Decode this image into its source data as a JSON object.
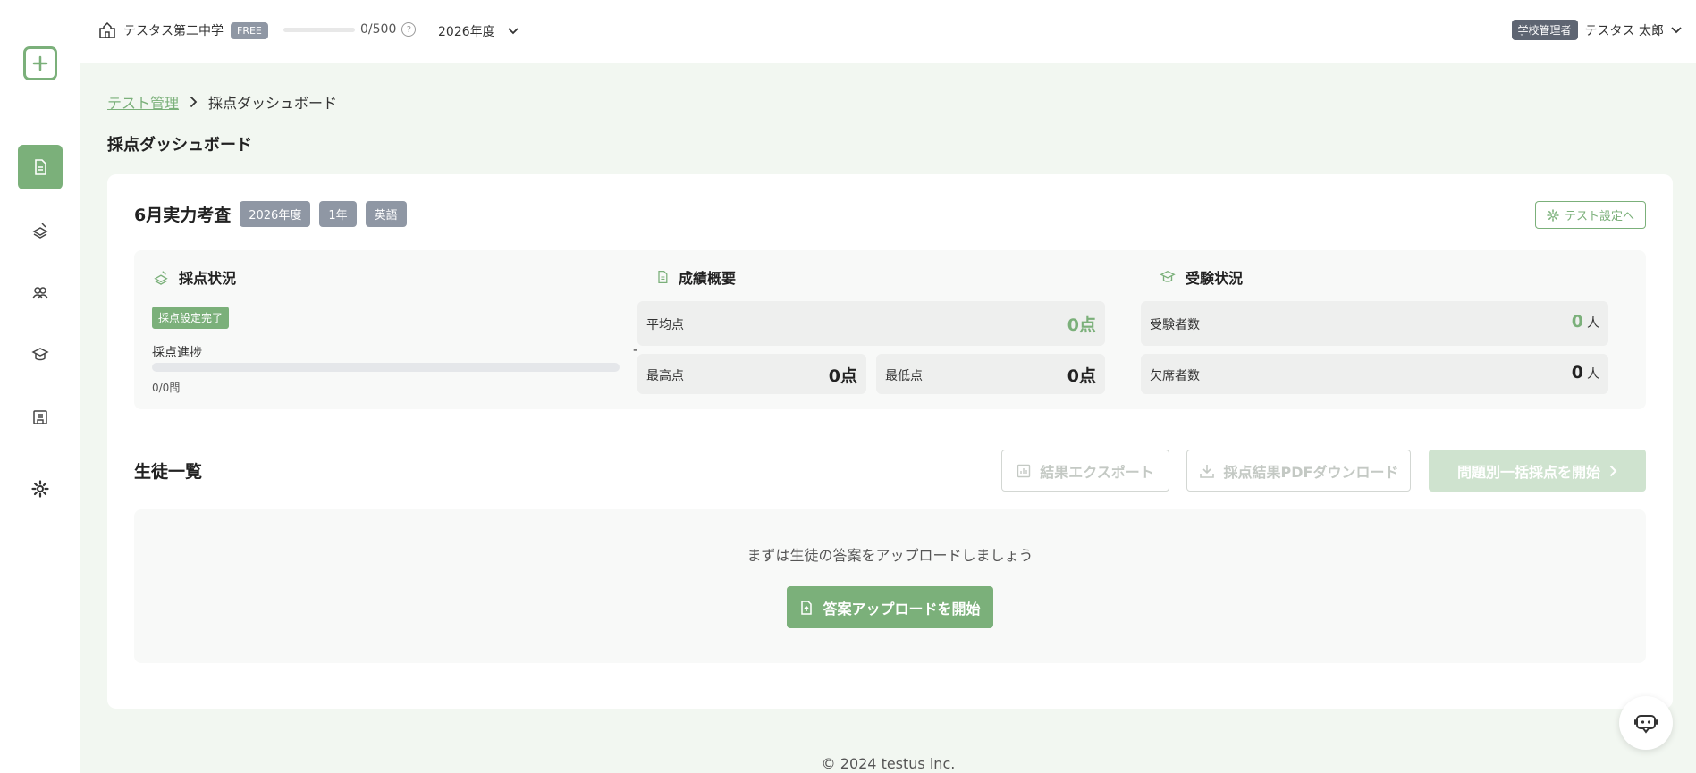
{
  "header": {
    "school_name": "テスタス第二中学",
    "plan_badge": "FREE",
    "quota_text": "0/500",
    "quota_fraction": 0,
    "help_glyph": "?",
    "year": "2026年度",
    "role_badge": "学校管理者",
    "user_name": "テスタス 太郎"
  },
  "sidebar": {
    "items": [
      {
        "icon": "document-icon",
        "active": true
      },
      {
        "icon": "grading-icon",
        "active": false
      },
      {
        "icon": "students-icon",
        "active": false
      },
      {
        "icon": "graduation-cap-icon",
        "active": false
      },
      {
        "icon": "book-icon",
        "active": false
      },
      {
        "icon": "gear-icon",
        "active": false
      }
    ]
  },
  "breadcrumb": {
    "parent": "テスト管理",
    "current": "採点ダッシュボード"
  },
  "page_title": "採点ダッシュボード",
  "test": {
    "title": "6月実力考査",
    "tags": [
      "2026年度",
      "1年",
      "英語"
    ],
    "settings_button": "テスト設定へ"
  },
  "grading_status": {
    "heading": "採点状況",
    "badge": "採点設定完了",
    "progress_label": "採点進捗",
    "progress_value_text": "-",
    "progress_fraction": 0,
    "progress_count": "0/0問"
  },
  "score_summary": {
    "heading": "成績概要",
    "average_label": "平均点",
    "average_value": "0点",
    "max_label": "最高点",
    "max_value": "0点",
    "min_label": "最低点",
    "min_value": "0点"
  },
  "exam_status": {
    "heading": "受験状況",
    "examinees_label": "受験者数",
    "examinees_value": "0",
    "examinees_unit": "人",
    "absent_label": "欠席者数",
    "absent_value": "0",
    "absent_unit": "人"
  },
  "students": {
    "heading": "生徒一覧",
    "export_button": "結果エクスポート",
    "pdf_button": "採点結果PDFダウンロード",
    "bulk_grade_button": "問題別一括採点を開始",
    "empty_message": "まずは生徒の答案をアップロードしましょう",
    "upload_button": "答案アップロードを開始"
  },
  "footer": {
    "copyright": "© 2024 testus inc."
  },
  "colors": {
    "accent": "#7bb07a",
    "background": "#f2f7f1",
    "tag": "#8f97a4"
  }
}
